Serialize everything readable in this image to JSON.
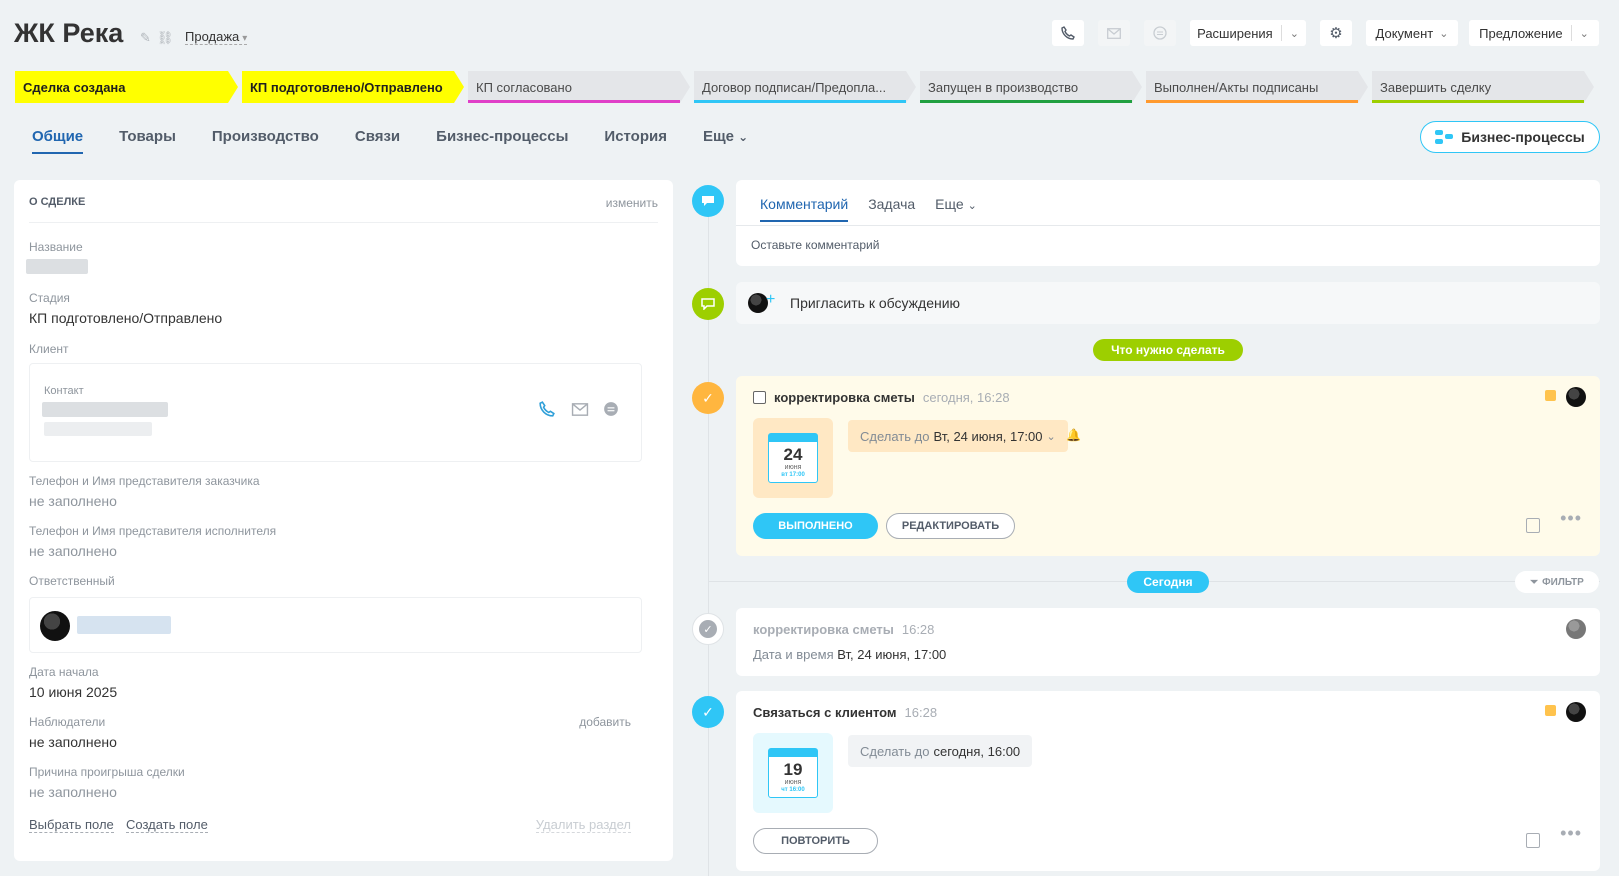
{
  "header": {
    "title": "ЖК Река",
    "category": "Продажа",
    "extensions_label": "Расширения",
    "document_label": "Документ",
    "offer_label": "Предложение"
  },
  "stages": [
    {
      "label": "Сделка создана",
      "state": "active",
      "color": "#ffff00"
    },
    {
      "label": "КП подготовлено/Отправлено",
      "state": "active",
      "color": "#ffff00"
    },
    {
      "label": "КП согласовано",
      "state": "inactive",
      "color": "#e040c8"
    },
    {
      "label": "Договор подписан/Предопла...",
      "state": "inactive",
      "color": "#2fc6f6"
    },
    {
      "label": "Запущен в производство",
      "state": "inactive",
      "color": "#20a040"
    },
    {
      "label": "Выполнен/Акты подписаны",
      "state": "inactive",
      "color": "#ff9a2e"
    },
    {
      "label": "Завершить сделку",
      "state": "inactive",
      "color": "#9dcf00"
    }
  ],
  "tabs": {
    "general": "Общие",
    "goods": "Товары",
    "production": "Производство",
    "links": "Связи",
    "business": "Бизнес-процессы",
    "history": "История",
    "more": "Еще"
  },
  "bp_button": "Бизнес-процессы",
  "deal": {
    "section_title": "О СДЕЛКЕ",
    "edit": "изменить",
    "name_label": "Название",
    "stage_label": "Стадия",
    "stage_value": "КП подготовлено/Отправлено",
    "client_label": "Клиент",
    "contact_label": "Контакт",
    "customer_rep_label": "Телефон и Имя представителя заказчика",
    "customer_rep_value": "не заполнено",
    "executor_rep_label": "Телефон и Имя представителя исполнителя",
    "executor_rep_value": "не заполнено",
    "responsible_label": "Ответственный",
    "start_date_label": "Дата начала",
    "start_date_value": "10 июня 2025",
    "observers_label": "Наблюдатели",
    "observers_add": "добавить",
    "observers_value": "не заполнено",
    "lose_reason_label": "Причина проигрыша сделки",
    "lose_reason_value": "не заполнено",
    "select_field": "Выбрать поле",
    "create_field": "Создать поле",
    "delete_section": "Удалить раздел"
  },
  "timeline": {
    "comment_tab": "Комментарий",
    "task_tab": "Задача",
    "more_tab": "Еще",
    "comment_placeholder": "Оставьте комментарий",
    "invite": "Пригласить к обсуждению",
    "todo_pill": "Что нужно сделать",
    "today_pill": "Сегодня",
    "filter": "ФИЛЬТР",
    "task1": {
      "title": "корректировка сметы",
      "time": "сегодня, 16:28",
      "deadline_label": "Сделать до",
      "deadline_value": "Вт, 24 июня, 17:00",
      "cal_day": "24",
      "cal_month": "июня",
      "cal_dt": "вт 17:00",
      "done_btn": "ВЫПОЛНЕНО",
      "edit_btn": "РЕДАКТИРОВАТЬ"
    },
    "history1": {
      "title": "корректировка сметы",
      "time": "16:28",
      "line": "Дата и время",
      "line_value": "Вт, 24 июня, 17:00"
    },
    "task2": {
      "title": "Связаться с клиентом",
      "time": "16:28",
      "deadline_label": "Сделать до",
      "deadline_value": "сегодня, 16:00",
      "cal_day": "19",
      "cal_month": "июня",
      "cal_dt": "чт 16:00",
      "repeat_btn": "ПОВТОРИТЬ"
    }
  }
}
